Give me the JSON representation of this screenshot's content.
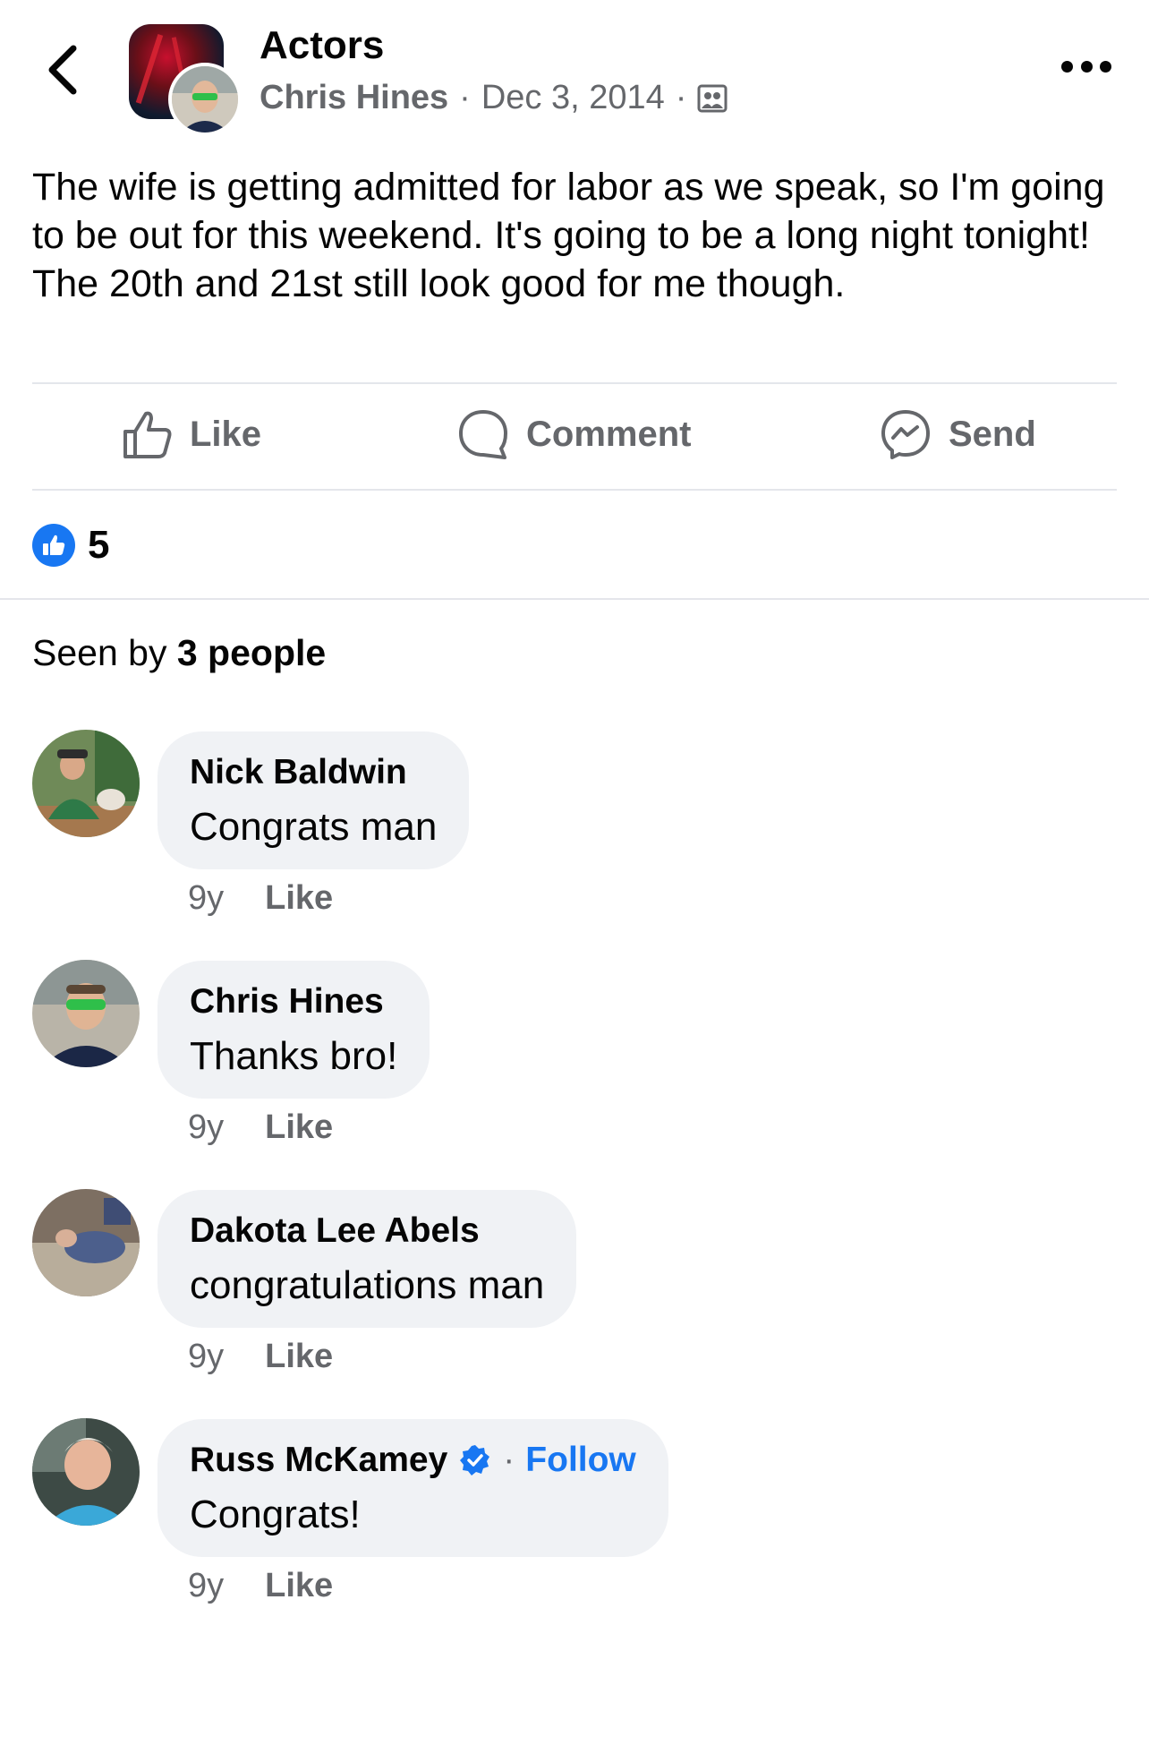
{
  "header": {
    "group_name": "Actors",
    "author": "Chris Hines",
    "dot": "·",
    "date": "Dec 3, 2014",
    "privacy_icon": "group-members-icon"
  },
  "post": {
    "text": "The wife is getting admitted for labor as we speak, so I'm going to be out for this weekend. It's going to be a long night tonight! The 20th and 21st still look good for me though."
  },
  "actions": {
    "like": "Like",
    "comment": "Comment",
    "send": "Send"
  },
  "reactions": {
    "count": "5"
  },
  "seen": {
    "prefix": "Seen by",
    "count": "3 people"
  },
  "comments": [
    {
      "name": "Nick Baldwin",
      "text": "Congrats man",
      "time": "9y",
      "like": "Like"
    },
    {
      "name": "Chris Hines",
      "text": "Thanks bro!",
      "time": "9y",
      "like": "Like"
    },
    {
      "name": "Dakota Lee Abels",
      "text": "congratulations man",
      "time": "9y",
      "like": "Like"
    },
    {
      "name": "Russ McKamey",
      "text": "Congrats!",
      "time": "9y",
      "like": "Like",
      "follow": "Follow",
      "dot": "·"
    }
  ],
  "colors": {
    "accent": "#1877f2",
    "secondary_text": "#65676b",
    "bubble": "#f0f2f5"
  }
}
